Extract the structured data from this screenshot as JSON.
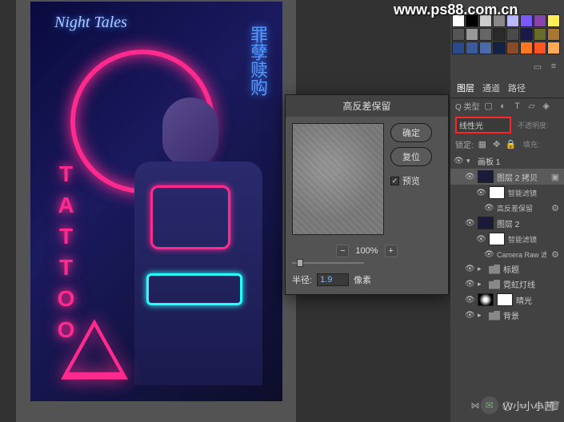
{
  "watermark_top": "www.ps88.com.cn",
  "watermark_bottom": "W小小小茜",
  "canvas": {
    "night_tales": "Night Tales",
    "tattoo": "TATTOO",
    "cn_sign": "罪孽赎购"
  },
  "dialog": {
    "title": "高反差保留",
    "ok": "确定",
    "cancel": "复位",
    "preview_label": "预览",
    "zoom_percent": "100%",
    "radius_label": "半径:",
    "radius_value": "1.9",
    "radius_unit": "像素"
  },
  "panels": {
    "tabs": [
      "图层",
      "通道",
      "路径"
    ],
    "search_label": "Q 类型",
    "blend_mode": "线性光",
    "opacity_label": "不透明度:",
    "fill_label": "填充:",
    "lock_label": "锁定:",
    "layers": {
      "artboard": "画板 1",
      "layer2_copy": "图层 2 拷贝",
      "smart_filter": "智能滤镜",
      "high_pass": "高反差保留",
      "layer2": "图层 2",
      "camera_raw": "Camera Raw 滤镜",
      "title_group": "标题",
      "neon_group": "霓虹灯线",
      "glow_layer": "晴光",
      "bg_group": "背景"
    }
  },
  "swatch_rows": [
    [
      "#ffffff",
      "#000000",
      "#cccccc",
      "#888888",
      "#b8b8ff",
      "#7a5aff",
      "#8844aa",
      "#ffee55"
    ],
    [
      "#555555",
      "#999999",
      "#666666",
      "#2a2a2a",
      "#4a4a4a",
      "#1a1a4a",
      "#6a6a2a",
      "#aa7733"
    ],
    [
      "#2a4a8a",
      "#3a5a9a",
      "#4a6aaa",
      "#112244",
      "#8a4a2a",
      "#ff7722",
      "#ff5522",
      "#ffaa55"
    ]
  ]
}
